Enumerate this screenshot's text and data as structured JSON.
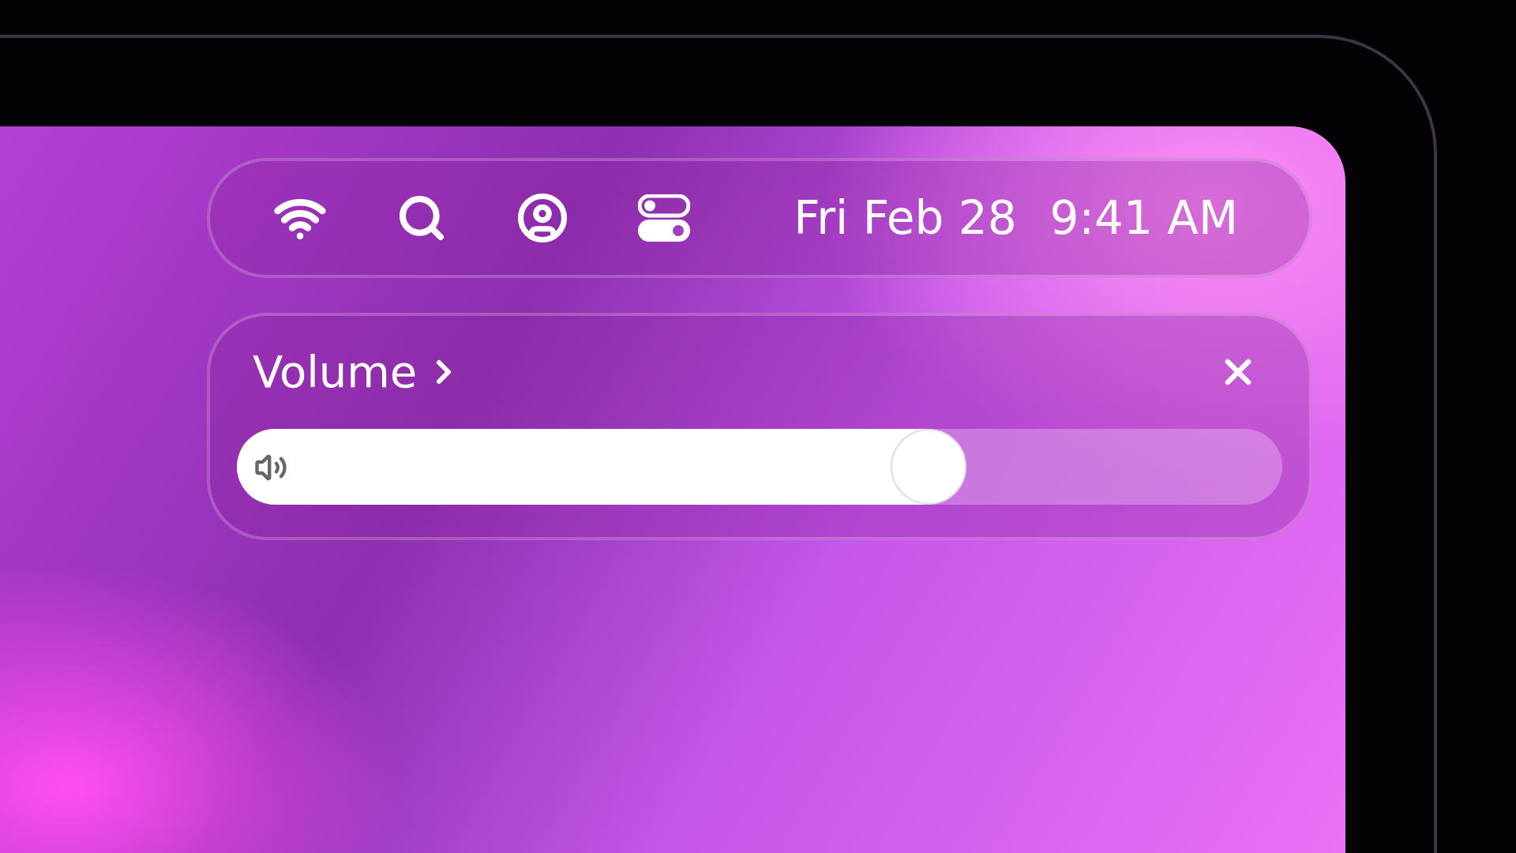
{
  "menu_bar": {
    "date": "Fri Feb 28",
    "time": "9:41 AM"
  },
  "volume_panel": {
    "title": "Volume",
    "slider": {
      "level": 0.66
    }
  }
}
